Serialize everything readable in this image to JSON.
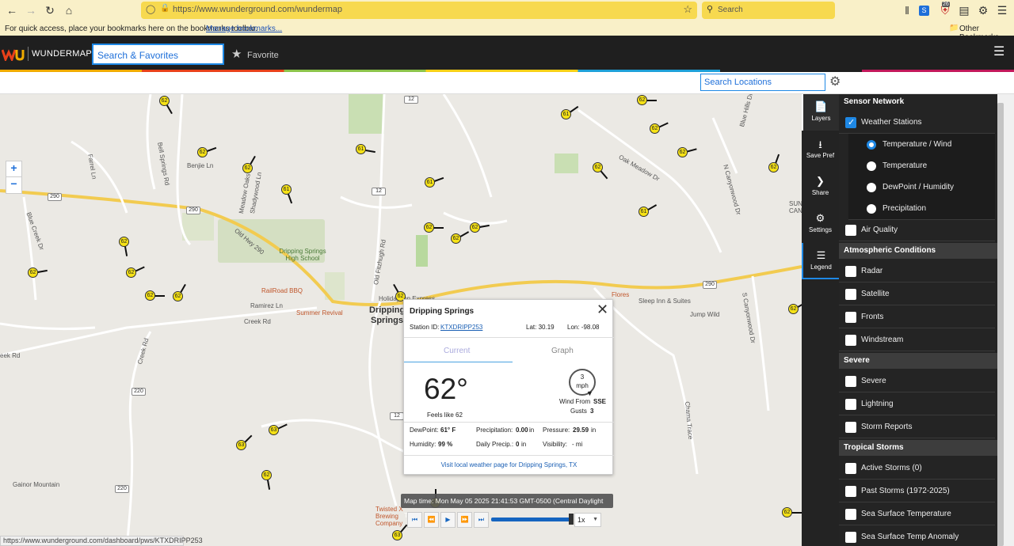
{
  "browser": {
    "url": "https://www.wunderground.com/wundermap",
    "search_placeholder": "Search",
    "bookmarks_prompt": "For quick access, place your bookmarks here on the bookmarks toolbar.",
    "manage_bookmarks": "Manage bookmarks...",
    "other_bookmarks": "Other Bookmarks",
    "badge_count": "26",
    "status_url": "https://www.wunderground.com/dashboard/pws/KTXDRIPP253"
  },
  "site": {
    "logo_text": "WUNDERMAP",
    "search_placeholder": "Search & Favorites",
    "favorite_label": "Favorite",
    "search_locations_placeholder": "Search Locations"
  },
  "map": {
    "zoom_in": "+",
    "zoom_out": "−",
    "labels": [
      "Benjie Ln",
      "Bell Springs Rd",
      "Farrel Ln",
      "Blue Creek Dr",
      "Meadow Oaks Dr",
      "Shadywood Ln",
      "Old Hwy 290",
      "Dripping Springs High School",
      "RailRoad BBQ",
      "Summer Revival",
      "Ramirez Ln",
      "Creek Rd",
      "Creek Rd",
      "Gainor Mountain",
      "Old Fitzhugh Rd",
      "Holiday Inn Express",
      "Flores",
      "Sleep Inn & Suites",
      "Jump Wild",
      "Oak Meadow Dr",
      "N Canyonwood Dr",
      "Blue Hills Dr",
      "Chama Trace",
      "S Canyonwood Dr",
      "Twisted X Brewing Company",
      "eek Rd",
      "SUN CAN"
    ],
    "city_label_1": "Dripping",
    "city_label_2": "Springs",
    "roads": [
      "290",
      "290",
      "290",
      "12",
      "12",
      "12",
      "220",
      "220"
    ],
    "stations": [
      "62",
      "62",
      "62",
      "61",
      "61",
      "61",
      "62",
      "62",
      "62",
      "62",
      "62",
      "62",
      "62",
      "62",
      "61",
      "62",
      "62",
      "62",
      "61",
      "62",
      "62",
      "62",
      "63",
      "63",
      "62",
      "62",
      "62",
      "62",
      "63"
    ],
    "map_time": "Map time: Mon May 05 2025 21:41:53 GMT-0500 (Central Daylight Time)",
    "speed": "1x"
  },
  "popup": {
    "station_name": "Dripping Springs",
    "station_id_label": "Station ID:",
    "station_id": "KTXDRIPP253",
    "lat": "Lat: 30.19",
    "lon": "Lon: -98.08",
    "tab_current": "Current",
    "tab_graph": "Graph",
    "temperature": "62°",
    "feels_like": "Feels like 62",
    "wind_speed": "3",
    "wind_unit": "mph",
    "wind_from_label": "Wind From",
    "wind_from": "SSE",
    "gusts_label": "Gusts",
    "gusts": "3",
    "dewpoint_label": "DewPoint:",
    "dewpoint": "61° F",
    "precip_label": "Precipitation:",
    "precip": "0.00",
    "precip_unit": "in",
    "pressure_label": "Pressure:",
    "pressure": "29.59",
    "pressure_unit": "in",
    "humidity_label": "Humidity:",
    "humidity": "99 %",
    "daily_precip_label": "Daily Precip.:",
    "daily_precip": "0",
    "daily_precip_unit": "in",
    "visibility_label": "Visibility:",
    "visibility": "- mi",
    "local_link": "Visit local weather page for Dripping Springs, TX"
  },
  "panel_tabs": [
    {
      "label": "Layers"
    },
    {
      "label": "Save Pref"
    },
    {
      "label": "Share"
    },
    {
      "label": "Settings"
    },
    {
      "label": "Legend"
    }
  ],
  "layers": {
    "sensor_network": "Sensor Network",
    "weather_stations": "Weather Stations",
    "temp_wind": "Temperature / Wind",
    "temperature": "Temperature",
    "dewpoint_humidity": "DewPoint / Humidity",
    "precipitation": "Precipitation",
    "air_quality": "Air Quality",
    "atmospheric": "Atmospheric Conditions",
    "radar": "Radar",
    "satellite": "Satellite",
    "fronts": "Fronts",
    "windstream": "Windstream",
    "severe_head": "Severe",
    "severe": "Severe",
    "lightning": "Lightning",
    "storm_reports": "Storm Reports",
    "tropical": "Tropical Storms",
    "active_storms": "Active Storms (0)",
    "past_storms": "Past Storms (1972-2025)",
    "sst": "Sea Surface Temperature",
    "ssta": "Sea Surface Temp Anomaly"
  },
  "colors": {
    "accent": "#1e88e5",
    "station_fill": "#f6e216",
    "url_bar": "#f7d94f",
    "header_bg": "#1f1f1f",
    "panel_bg": "#242424"
  }
}
